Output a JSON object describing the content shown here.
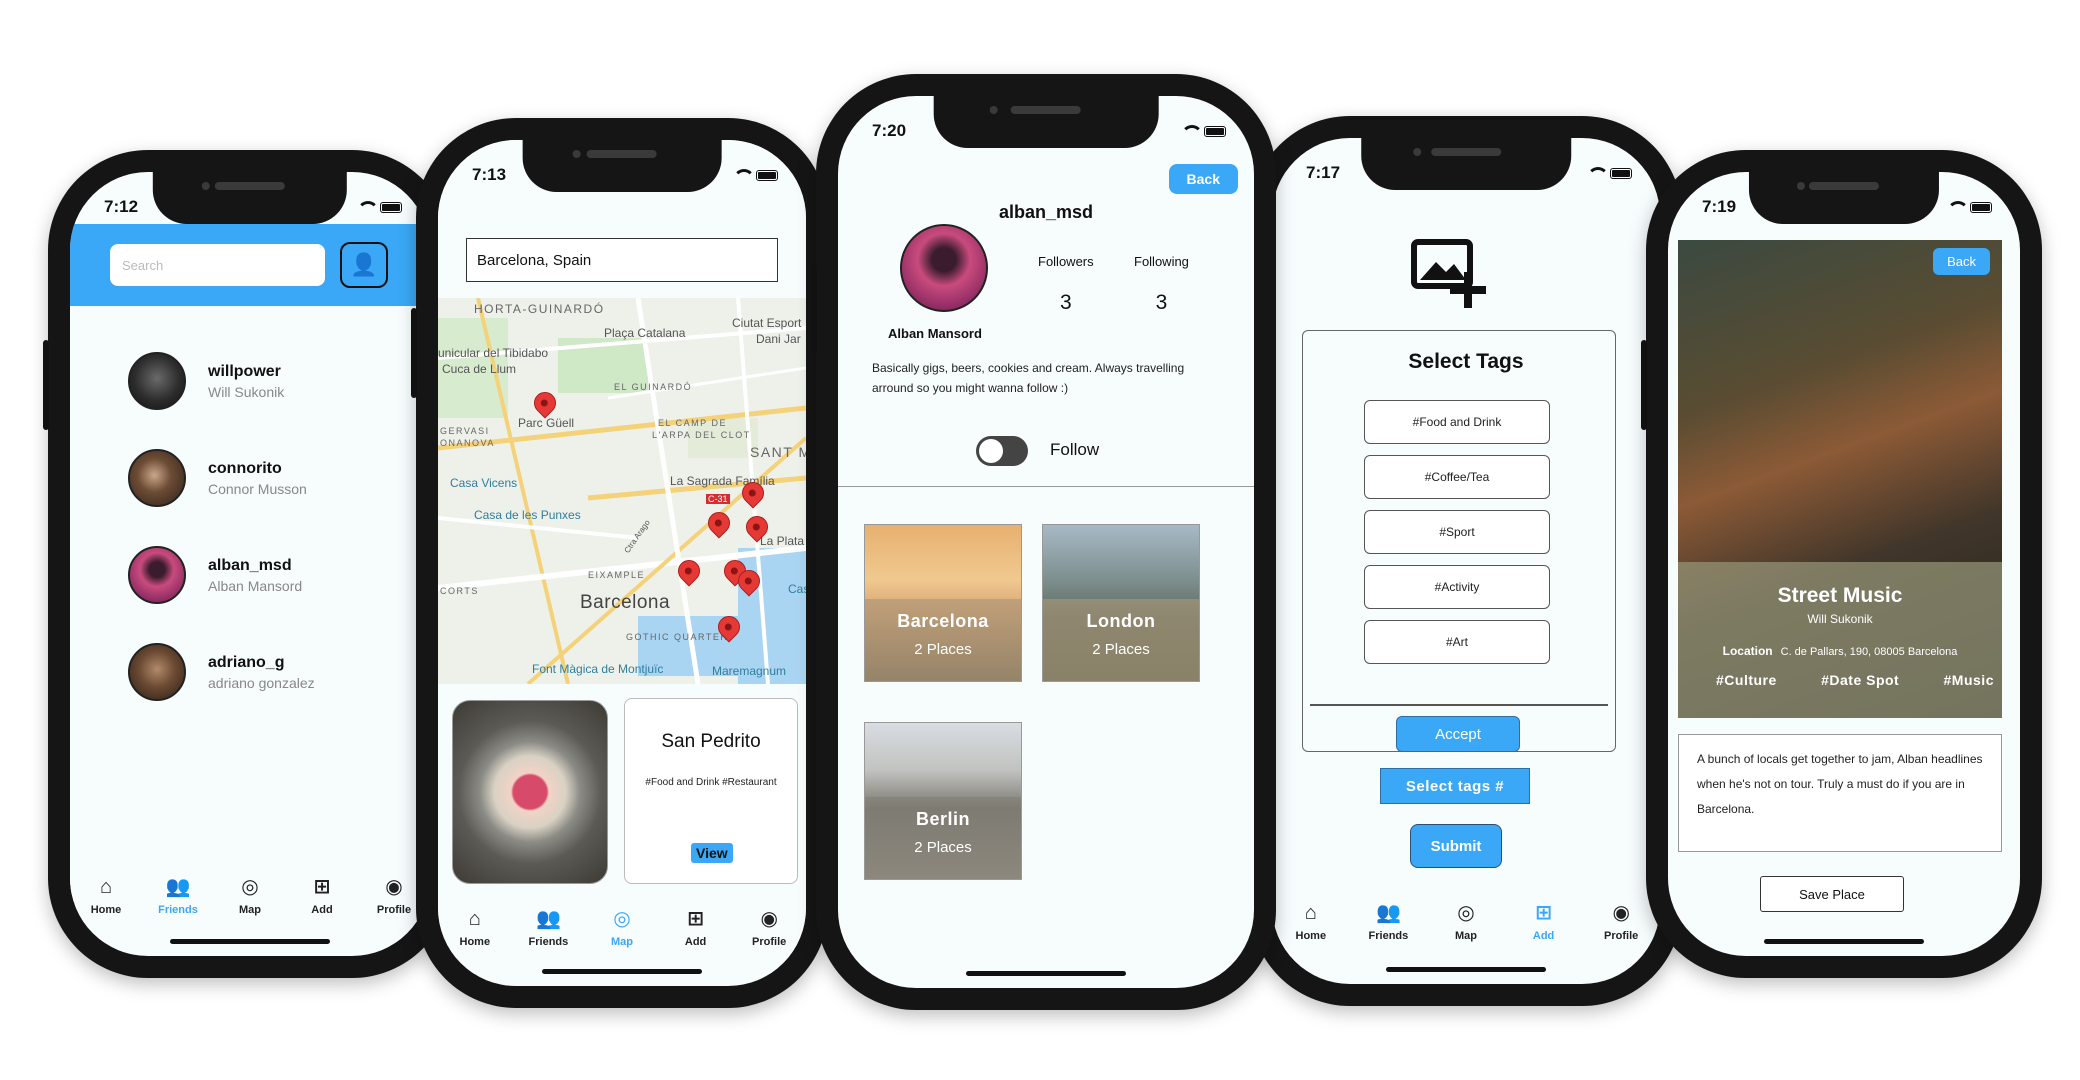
{
  "phones": [
    {
      "time": "7:12",
      "search_placeholder": "Search",
      "friends": [
        {
          "username": "willpower",
          "name": "Will Sukonik"
        },
        {
          "username": "connorito",
          "name": "Connor Musson"
        },
        {
          "username": "alban_msd",
          "name": "Alban Mansord"
        },
        {
          "username": "adriano_g",
          "name": "adriano gonzalez"
        }
      ],
      "tabs": [
        "Home",
        "Friends",
        "Map",
        "Add",
        "Profile"
      ],
      "active_tab": "Friends"
    },
    {
      "time": "7:13",
      "search_value": "Barcelona, Spain",
      "map_labels": {
        "horta": "HORTA-GUINARDÓ",
        "placa": "Plaça Catalana",
        "ciutat": "Ciutat Esport",
        "dani": "Dani Jar",
        "funicular": "unicular del Tibidabo",
        "cuca": "Cuca de Llum",
        "guinardo": "EL GUINARDÓ",
        "parc": "Parc Güell",
        "gervasi": "GERVASI",
        "bonanova": "ONANOVA",
        "camp": "EL CAMP DE",
        "arpa": "L'ARPA DEL CLOT",
        "sant": "SANT M",
        "vicens": "Casa Vicens",
        "familia": "La Sagrada Família",
        "c31": "C-31",
        "punxes": "Casa de les Punxes",
        "plata": "La Plata",
        "corts": "CORTS",
        "eixample": "EIXAMPLE",
        "barcelona": "Barcelona",
        "cas": "Cas",
        "gothic": "GOTHIC QUARTER",
        "font": "Font Màgica de Montjuïc",
        "mare": "Maremagnum",
        "diag": "Ctra Arago"
      },
      "place_title": "San Pedrito",
      "place_tags": "#Food and Drink  #Restaurant",
      "view_label": "View",
      "tabs": [
        "Home",
        "Friends",
        "Map",
        "Add",
        "Profile"
      ],
      "active_tab": "Map"
    },
    {
      "time": "7:20",
      "back_label": "Back",
      "username": "alban_msd",
      "name": "Alban Mansord",
      "followers_label": "Followers",
      "following_label": "Following",
      "followers": "3",
      "following": "3",
      "bio": "Basically gigs, beers, cookies and cream. Always travelling arround so you might wanna follow :)",
      "follow_label": "Follow",
      "follow_on": false,
      "cities": [
        {
          "name": "Barcelona",
          "places": "2 Places"
        },
        {
          "name": "London",
          "places": "2 Places"
        },
        {
          "name": "Berlin",
          "places": "2 Places"
        }
      ]
    },
    {
      "time": "7:17",
      "title": "Select Tags",
      "tags": [
        "#Food and Drink",
        "#Coffee/Tea",
        "#Sport",
        "#Activity",
        "#Art"
      ],
      "accept_label": "Accept",
      "select_tags_label": "Select tags #",
      "submit_label": "Submit",
      "tabs": [
        "Home",
        "Friends",
        "Map",
        "Add",
        "Profile"
      ],
      "active_tab": "Add"
    },
    {
      "time": "7:19",
      "back_label": "Back",
      "title": "Street Music",
      "author": "Will Sukonik",
      "location_label": "Location",
      "location": "C. de Pallars, 190, 08005 Barcelona",
      "tags": [
        "#Culture",
        "#Date Spot",
        "#Music"
      ],
      "description": "A bunch of locals get together to jam, Alban headlines when he's not on tour. Truly a must do if you are in Barcelona.",
      "save_label": "Save Place"
    }
  ],
  "colors": {
    "accent": "#3aa8f6",
    "pin": "#e53935",
    "phone_frame": "#151515"
  }
}
